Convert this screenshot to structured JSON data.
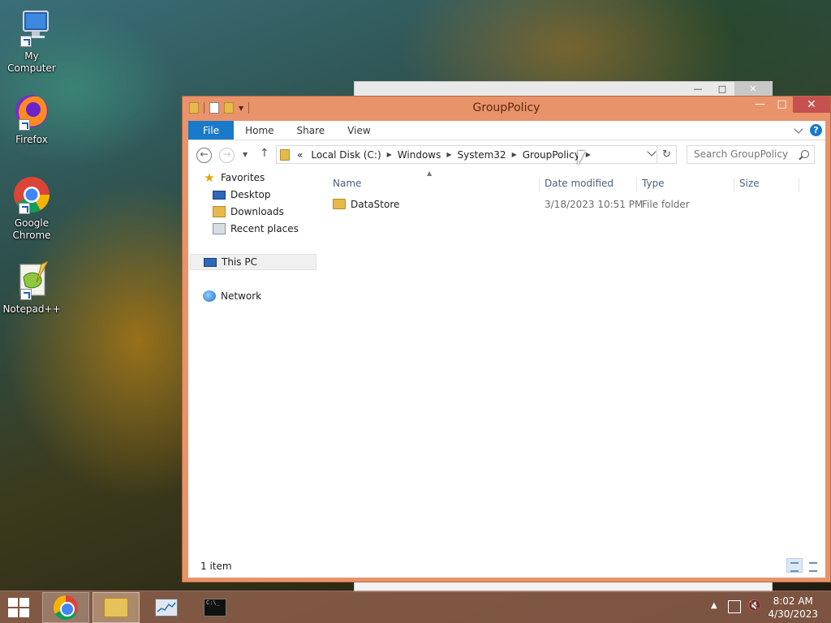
{
  "desktop": {
    "icons": [
      {
        "label": "My Computer",
        "icon": "computer-icon"
      },
      {
        "label": "Firefox",
        "icon": "firefox-icon"
      },
      {
        "label": "Google\nChrome",
        "icon": "chrome-icon"
      },
      {
        "label": "Notepad++",
        "icon": "notepadpp-icon"
      }
    ]
  },
  "window": {
    "title": "GroupPolicy",
    "ribbon": {
      "tabs": [
        "File",
        "Home",
        "Share",
        "View"
      ]
    },
    "address": {
      "overflow": "«",
      "crumbs": [
        "Local Disk (C:)",
        "Windows",
        "System32",
        "GroupPolicy"
      ]
    },
    "search": {
      "placeholder": "Search GroupPolicy"
    },
    "nav_pane": {
      "favorites": "Favorites",
      "desktop": "Desktop",
      "downloads": "Downloads",
      "recent": "Recent places",
      "this_pc": "This PC",
      "network": "Network"
    },
    "columns": [
      "Name",
      "Date modified",
      "Type",
      "Size"
    ],
    "files": [
      {
        "name": "DataStore",
        "date_modified": "3/18/2023 10:51 PM",
        "type": "File folder",
        "size": ""
      }
    ],
    "status": {
      "item_count": "1 item"
    }
  },
  "taskbar": {
    "apps": [
      "chrome-icon",
      "file-explorer-icon",
      "resource-monitor-icon",
      "cmd-icon"
    ],
    "clock": {
      "time": "8:02 AM",
      "date": "4/30/2023"
    }
  },
  "colors": {
    "window_frame": "#e8936a",
    "ribbon_file_tab": "#1979ca",
    "close_button": "#c75050"
  }
}
